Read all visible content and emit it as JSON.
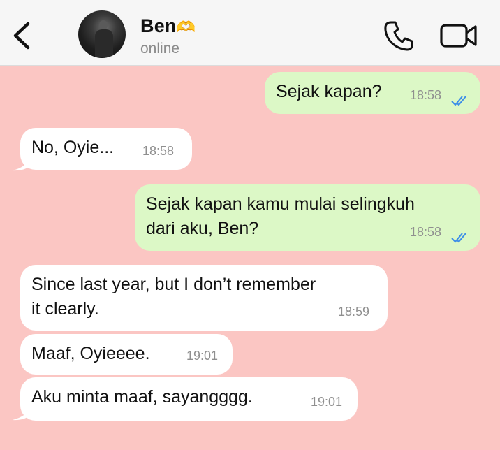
{
  "header": {
    "contact_name": "Ben",
    "name_emoji": "🫶",
    "status": "online",
    "icons": [
      "back-chevron-icon",
      "avatar",
      "phone-icon",
      "video-camera-icon"
    ]
  },
  "colors": {
    "chat_background": "#fbc6c3",
    "outgoing_bubble": "#dcf8c6",
    "incoming_bubble": "#ffffff",
    "read_ticks": "#3d8ee8"
  },
  "messages": [
    {
      "direction": "out",
      "text": "Sejak kapan?",
      "time": "18:58",
      "read": true
    },
    {
      "direction": "in",
      "text": "No, Oyie...",
      "time": "18:58"
    },
    {
      "direction": "out",
      "lines": [
        "Sejak kapan kamu mulai selingkuh",
        "dari aku, Ben?"
      ],
      "time": "18:58",
      "read": true
    },
    {
      "direction": "in",
      "lines": [
        "Since last year, but I don’t remember",
        "it clearly."
      ],
      "time": "18:59"
    },
    {
      "direction": "in",
      "text": "Maaf, Oyieeee.",
      "time": "19:01"
    },
    {
      "direction": "in",
      "text": "Aku minta maaf, sayangggg.",
      "time": "19:01"
    }
  ]
}
